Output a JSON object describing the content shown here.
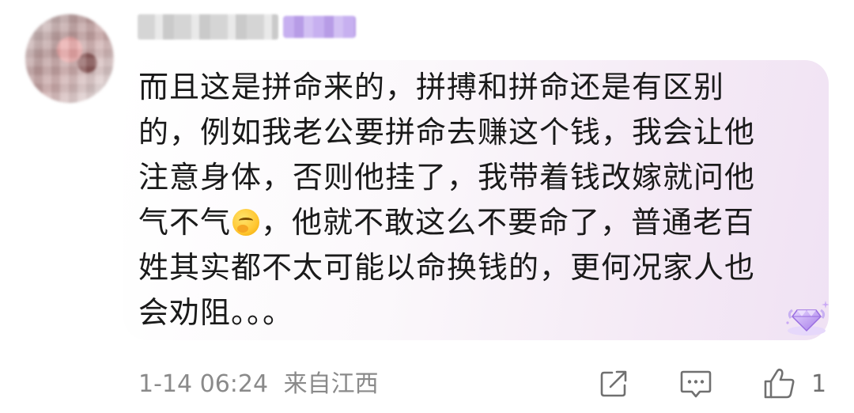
{
  "comment": {
    "lines": [
      "而且这是拼命来的，拼搏和拼命还是有区别",
      "的，例如我老公要拼命去赚这个钱，我会让他",
      "注意身体，否则他挂了，我带着钱改嫁就问他",
      "气不气",
      "，他就不敢这么不要命了，普通老百",
      "姓其实都不太可能以命换钱的，更何况家人也",
      "会劝阻。。。"
    ]
  },
  "footer": {
    "time": "1-14 06:24",
    "location": "来自江西",
    "like_count": "1"
  },
  "icons": {
    "avatar": "user-avatar",
    "emoji": "facepalm-emoji",
    "gem": "diamond-badge-icon",
    "share": "share-icon",
    "reply": "comment-icon",
    "like": "thumbs-up-icon"
  },
  "colors": {
    "text": "#1a1a1a",
    "meta": "#8a8a8a",
    "bubble_tint": "#f0e2f4",
    "gem": "#b48ef0"
  }
}
